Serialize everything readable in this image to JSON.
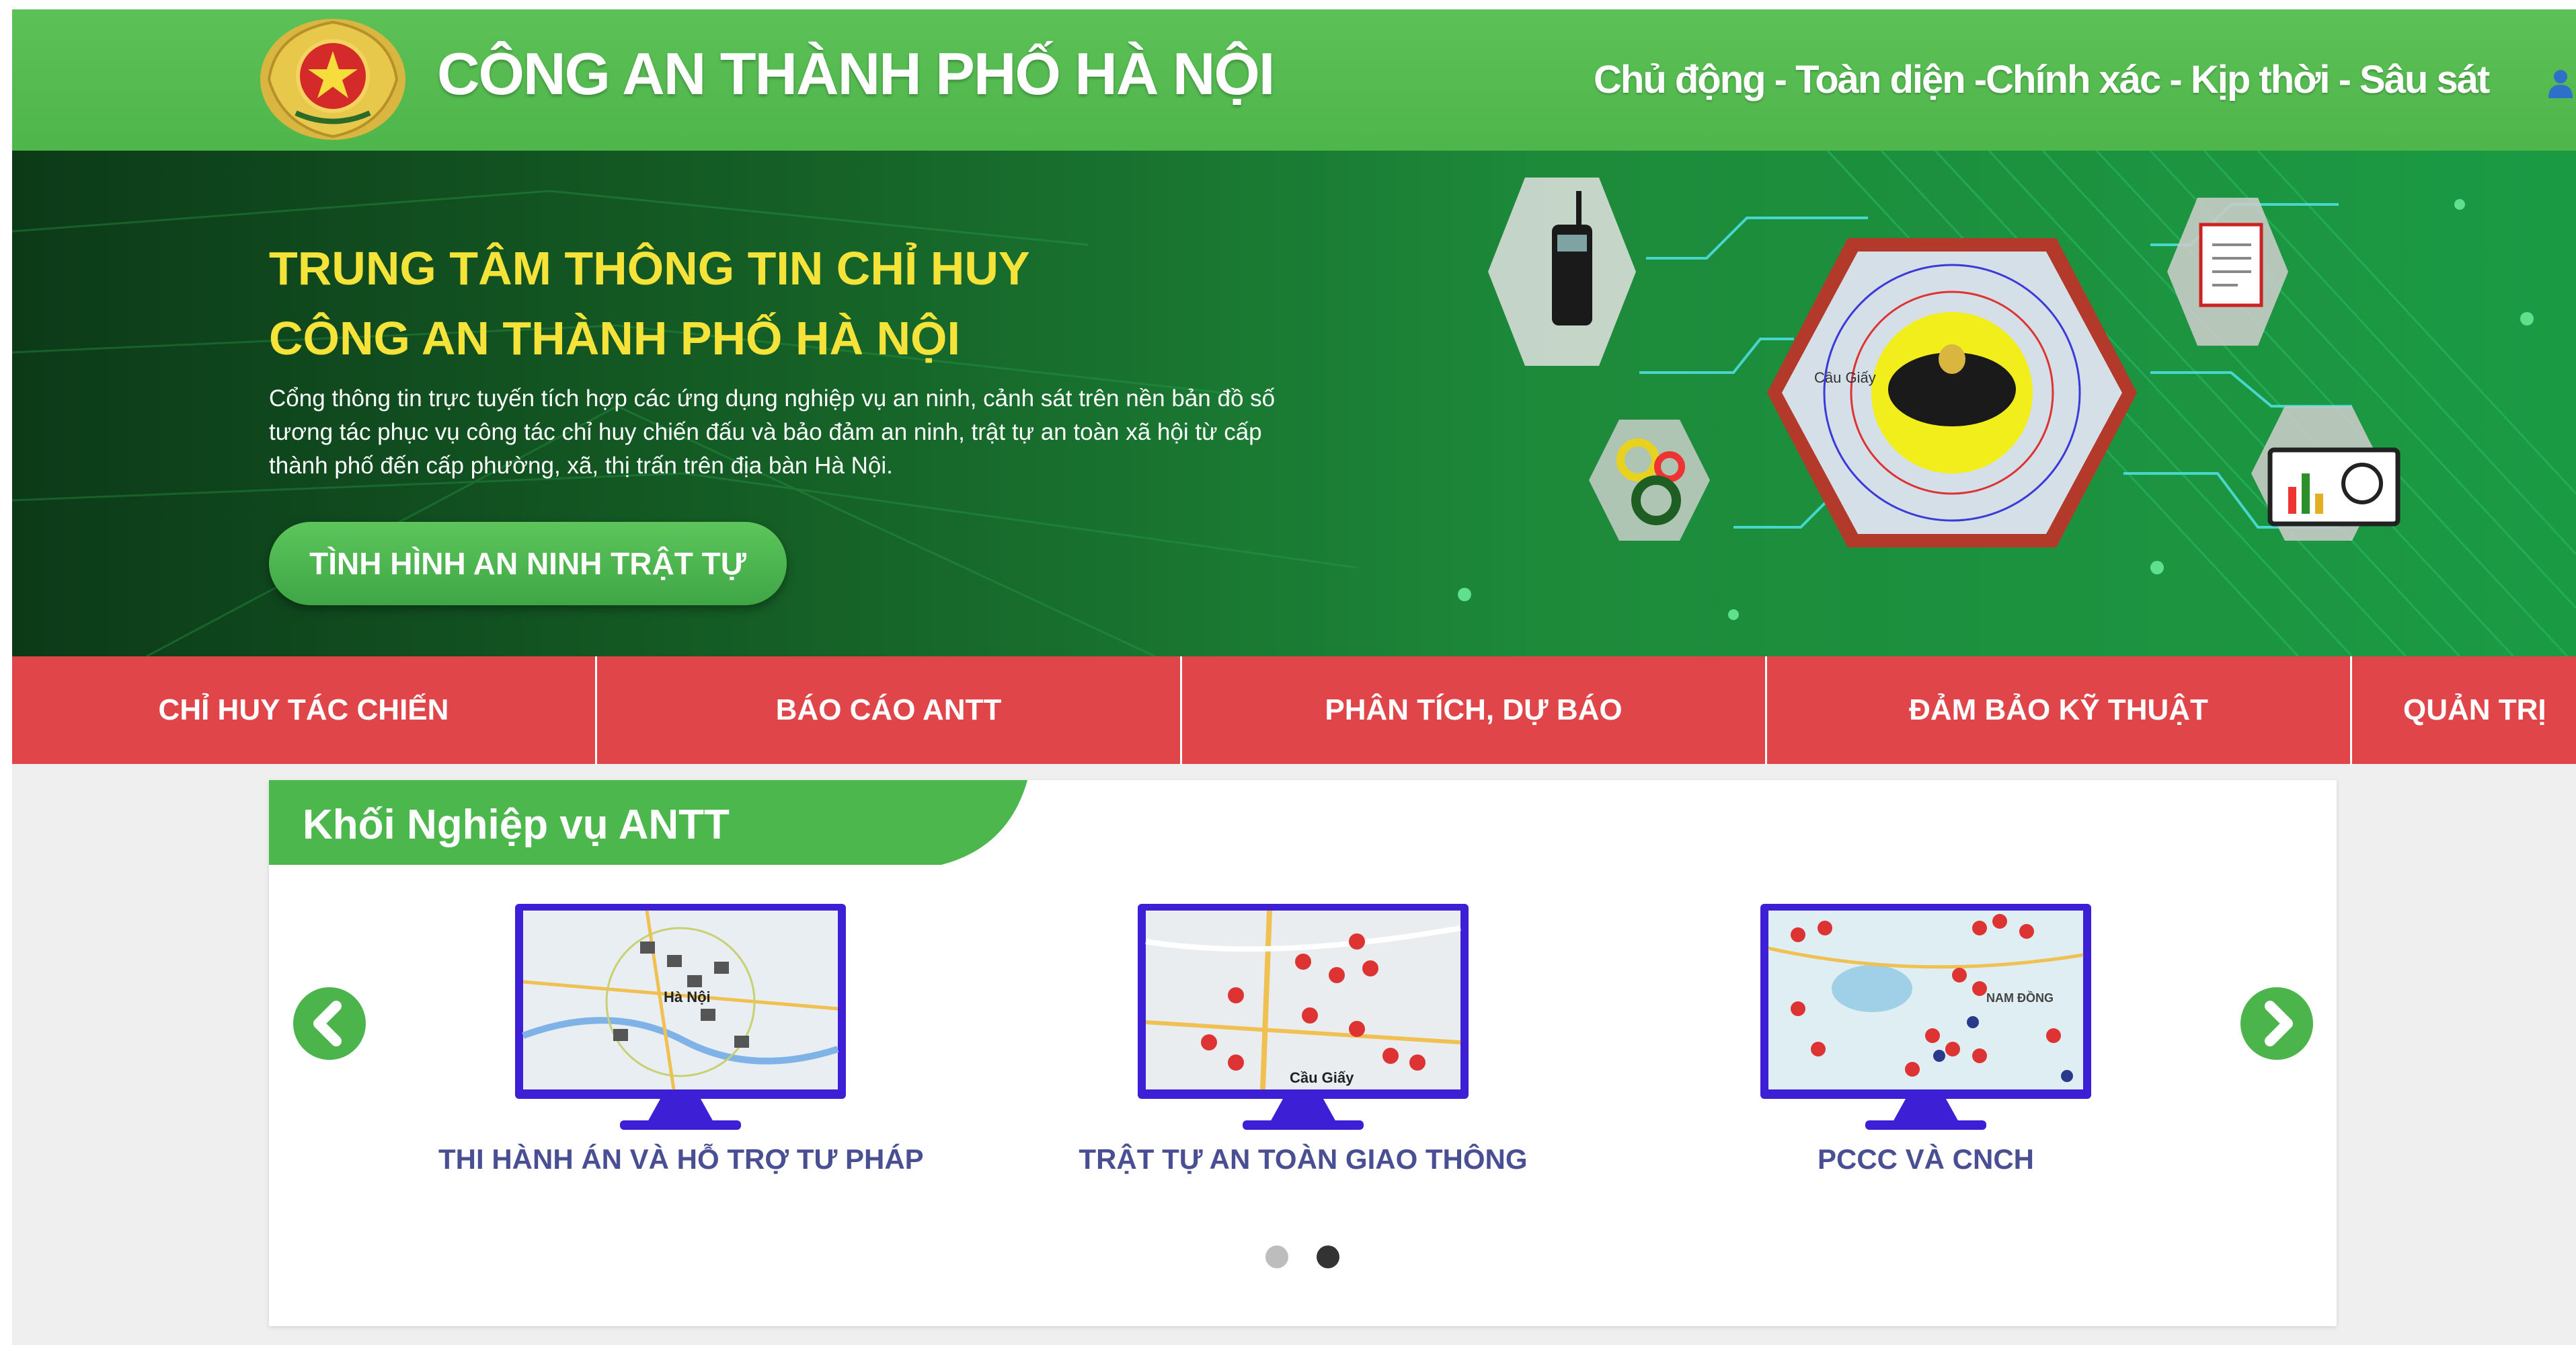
{
  "header": {
    "site_title": "CÔNG AN THÀNH PHỐ HÀ NỘI",
    "slogan": "Chủ động - Toàn diện -Chính xác - Kịp thời - Sâu sát",
    "emblem_icon": "police-emblem-icon",
    "user_icon": "user-icon"
  },
  "hero": {
    "title_line1": "TRUNG TÂM THÔNG TIN CHỈ HUY",
    "title_line2": "CÔNG AN THÀNH PHỐ HÀ NỘI",
    "description": "Cổng thông tin trực tuyến tích hợp các ứng dụng nghiệp vụ an ninh, cảnh sát trên nền bản đồ số tương tác phục vụ công tác chỉ huy chiến đấu và bảo đảm an ninh, trật tự an toàn xã hội từ cấp thành phố đến cấp phường, xã, thị trấn trên địa bàn Hà Nội.",
    "button_label": "TÌNH HÌNH AN NINH TRẬT TỰ"
  },
  "nav": {
    "items": [
      {
        "label": "CHỈ HUY TÁC CHIẾN"
      },
      {
        "label": "BÁO CÁO ANTT"
      },
      {
        "label": "PHÂN TÍCH, DỰ BÁO"
      },
      {
        "label": "ĐẢM BẢO KỸ THUẬT"
      },
      {
        "label": "QUẢN TRỊ"
      }
    ]
  },
  "section": {
    "title": "Khối Nghiệp vụ ANTT",
    "cards": [
      {
        "label": "THI HÀNH ÁN VÀ HỖ TRỢ TƯ PHÁP",
        "map_text": "Hà Nội"
      },
      {
        "label": "TRẬT TỰ AN TOÀN GIAO THÔNG",
        "map_text": "Cầu Giấy"
      },
      {
        "label": "PCCC VÀ CNCH",
        "map_text": "NAM ĐỒNG"
      }
    ],
    "carousel": {
      "active_page": 2,
      "total_pages": 2
    }
  },
  "colors": {
    "header_green": "#55bb50",
    "nav_red": "#e0454a",
    "accent_green": "#4bb54c",
    "title_yellow": "#f5e33a",
    "card_label": "#4a4f93",
    "monitor_frame": "#3d1fd6"
  }
}
